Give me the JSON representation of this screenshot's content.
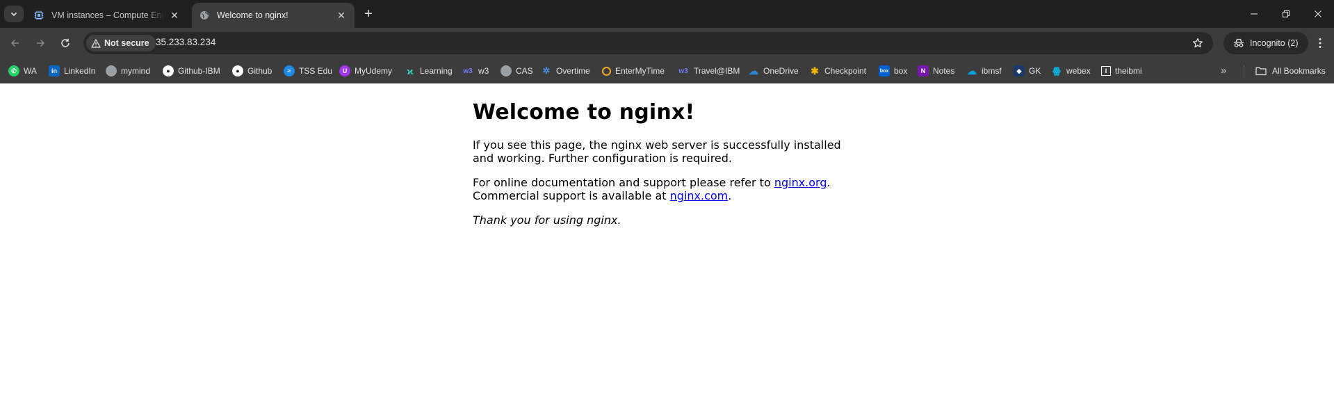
{
  "tabs": {
    "search_icon": "chevron-down-icon",
    "items": [
      {
        "title": "VM instances – Compute Engine",
        "icon": "compute-engine-icon",
        "active": false
      },
      {
        "title": "Welcome to nginx!",
        "icon": "globe-icon",
        "active": true
      }
    ],
    "new_tab_label": "+"
  },
  "toolbar": {
    "security_chip": "Not secure",
    "url": "35.233.83.234",
    "profile_label": "Incognito (2)"
  },
  "bookmarks": {
    "items": [
      {
        "label": "WA",
        "color": "#25d366"
      },
      {
        "label": "LinkedIn",
        "color": "#0a66c2"
      },
      {
        "label": "mymind",
        "color": "#9aa0a6"
      },
      {
        "label": "Github-IBM",
        "color": "#ffffff"
      },
      {
        "label": "Github",
        "color": "#ffffff"
      },
      {
        "label": "TSS Edu",
        "color": "#1e88e5"
      },
      {
        "label": "MyUdemy",
        "color": "#a435f0"
      },
      {
        "label": "Learning",
        "color": "#2dd4bf"
      },
      {
        "label": "w3",
        "color": "#6f7dff"
      },
      {
        "label": "CAS",
        "color": "#9aa0a6"
      },
      {
        "label": "Overtime",
        "color": "#4a90e2"
      },
      {
        "label": "EnterMyTime",
        "color": "#f5a623"
      },
      {
        "label": "Travel@IBM",
        "color": "#6f7dff"
      },
      {
        "label": "OneDrive",
        "color": "#0f6cbd"
      },
      {
        "label": "Checkpoint",
        "color": "#f5b800"
      },
      {
        "label": "box",
        "color": "#0061d5"
      },
      {
        "label": "Notes",
        "color": "#7719aa"
      },
      {
        "label": "ibmsf",
        "color": "#00a1e0"
      },
      {
        "label": "GK",
        "color": "#1a3a6b"
      },
      {
        "label": "webex",
        "color": "#00bceb"
      },
      {
        "label": "theibmi",
        "color": "#ffffff"
      }
    ],
    "all_bookmarks_label": "All Bookmarks"
  },
  "page": {
    "heading": "Welcome to nginx!",
    "para1": "If you see this page, the nginx web server is successfully installed and working. Further configuration is required.",
    "para2_prefix": "For online documentation and support please refer to ",
    "link1": "nginx.org",
    "para2_mid": ".",
    "para2_line2_prefix": "Commercial support is available at ",
    "link2": "nginx.com",
    "para2_suffix": ".",
    "thanks": "Thank you for using nginx."
  }
}
